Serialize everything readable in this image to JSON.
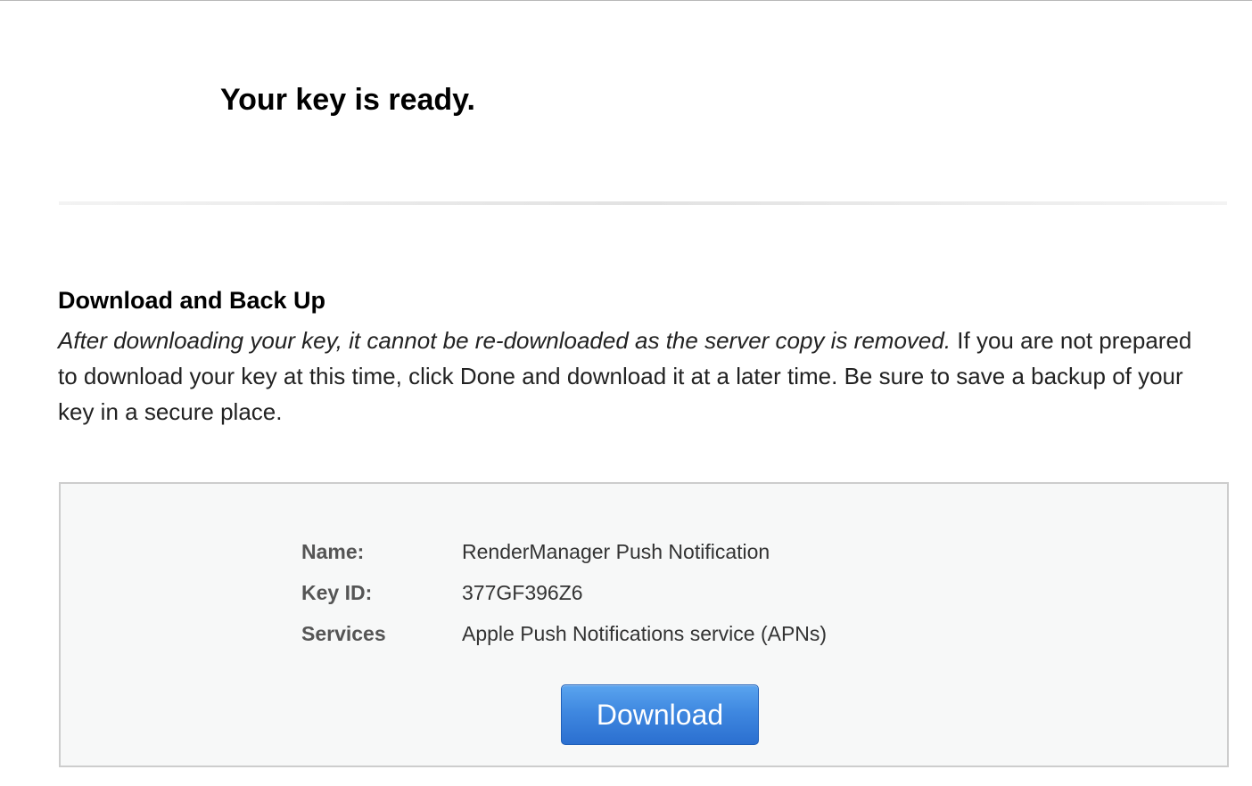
{
  "page": {
    "title": "Your key is ready."
  },
  "section": {
    "title": "Download and Back Up",
    "body_italic": "After downloading your key, it cannot be re-downloaded as the server copy is removed.",
    "body_rest": " If you are not prepared to download your key at this time, click Done and download it at a later time. Be sure to save a backup of your key in a secure place."
  },
  "key_details": {
    "rows": [
      {
        "label": "Name:",
        "value": "RenderManager Push Notification"
      },
      {
        "label": "Key ID:",
        "value": "377GF396Z6"
      },
      {
        "label": "Services",
        "value": "Apple Push Notifications service (APNs)"
      }
    ]
  },
  "actions": {
    "download_label": "Download"
  },
  "colors": {
    "button_primary": "#3f88e0",
    "panel_background": "#f7f8f8",
    "panel_border": "#cdcdcd"
  }
}
